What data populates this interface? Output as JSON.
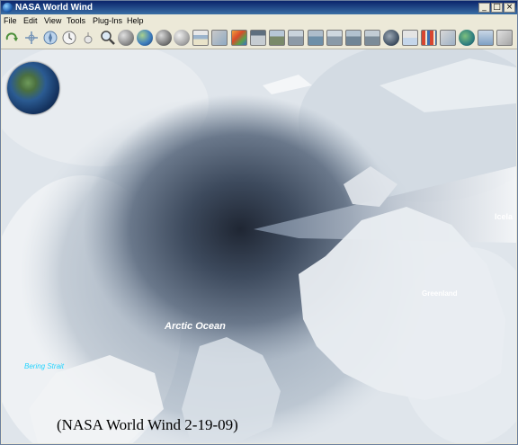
{
  "window": {
    "title": "NASA World Wind",
    "controls": [
      "_",
      "□",
      "×"
    ]
  },
  "menubar": {
    "items": [
      "File",
      "Edit",
      "View",
      "Tools",
      "Plug-Ins",
      "Help"
    ]
  },
  "toolbar": {
    "buttons": [
      "refresh-icon",
      "crosshair-icon",
      "compass-icon",
      "clock-icon",
      "pin-icon",
      "magnifier-icon",
      "globe-gray-icon",
      "globe-color-icon",
      "globe-star-icon",
      "globe-moon-icon",
      "layers-icon",
      "map-tile-icon",
      "terrain-icon",
      "image-layer-icon",
      "image-layer-2-icon",
      "image-layer-3-icon",
      "image-layer-4-icon",
      "image-layer-5-icon",
      "image-layer-6-icon",
      "image-layer-7-icon",
      "globe-night-icon",
      "chart-icon",
      "grid-icon",
      "earth-icon",
      "usa-map-icon",
      "settings-icon"
    ]
  },
  "map": {
    "labels": {
      "arctic_ocean": "Arctic Ocean",
      "greenland": "Greenland",
      "bering_strait": "Bering Strait",
      "iceland": "Icela"
    },
    "caption": "(NASA World Wind 2-19-09)"
  },
  "colors": {
    "titlebar": "#0a246a",
    "chrome": "#ece9d8",
    "label_white": "#ffffff",
    "label_cyan": "#22d4ff"
  }
}
